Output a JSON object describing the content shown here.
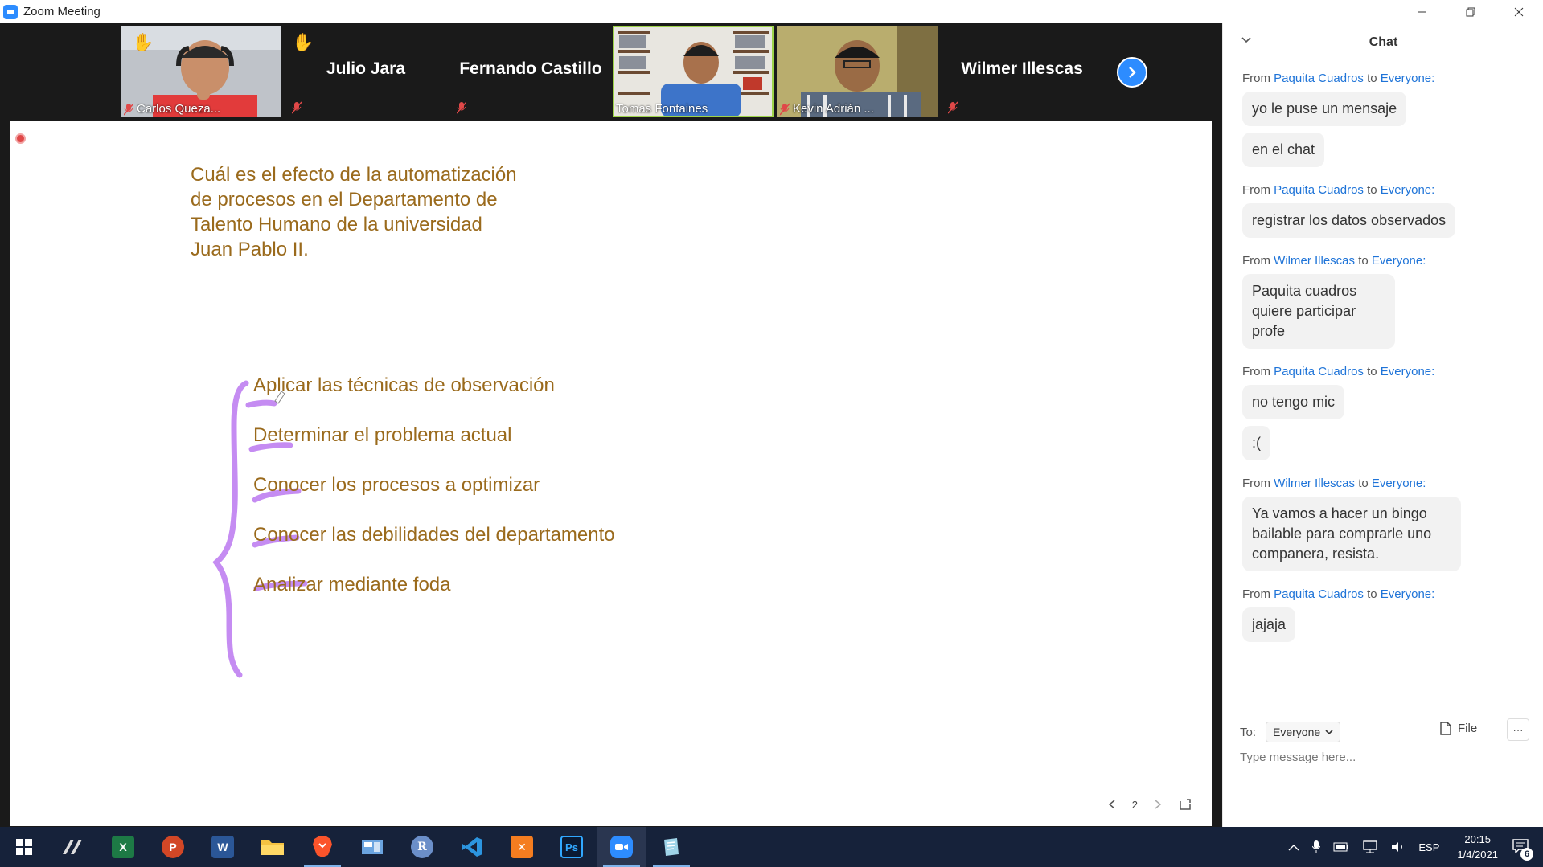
{
  "window": {
    "title": "Zoom Meeting"
  },
  "participants": [
    {
      "name": "Carlos Queza...",
      "type": "video",
      "hand_raised": true,
      "muted": true
    },
    {
      "name": "Julio Jara",
      "type": "name",
      "hand_raised": true,
      "muted": true
    },
    {
      "name": "Fernando Castillo",
      "type": "name",
      "hand_raised": false,
      "muted": true
    },
    {
      "name": "Tomas Fontaines",
      "type": "video",
      "active_speaker": true,
      "muted": false
    },
    {
      "name": "Kevin Adrián ...",
      "type": "video",
      "muted": true
    },
    {
      "name": "Wilmer Illescas",
      "type": "name",
      "muted": true
    }
  ],
  "whiteboard": {
    "question": "Cuál es el efecto de la automatización de procesos en el Departamento de Talento Humano de la universidad Juan Pablo II.",
    "bullets": [
      "Aplicar las técnicas de observación",
      "Determinar el problema actual",
      "Conocer los procesos a optimizar",
      "Conocer las debilidades del departamento",
      "Analizar mediante foda"
    ],
    "page": "2",
    "text_color": "#9a6a1c",
    "ink_color": "#c58cf2"
  },
  "chat": {
    "title": "Chat",
    "messages": [
      {
        "from": "Paquita Cuadros",
        "to": "Everyone:",
        "texts": [
          "yo le puse un mensaje",
          "en el chat"
        ]
      },
      {
        "from": "Paquita Cuadros",
        "to": "Everyone:",
        "texts": [
          "registrar los datos observados"
        ]
      },
      {
        "from": "Wilmer Illescas",
        "to": "Everyone:",
        "texts": [
          "Paquita cuadros quiere participar profe"
        ]
      },
      {
        "from": "Paquita Cuadros",
        "to": "Everyone:",
        "texts": [
          "no tengo mic",
          ":("
        ]
      },
      {
        "from": "Wilmer Illescas",
        "to": "Everyone:",
        "texts": [
          "Ya vamos a hacer un bingo bailable para comprarle uno companera, resista."
        ]
      },
      {
        "from": "Paquita Cuadros",
        "to": "Everyone:",
        "texts": [
          "jajaja"
        ]
      }
    ],
    "from_word": "From",
    "to_word": "to",
    "to_label": "To:",
    "recipient": "Everyone",
    "file_label": "File",
    "more_label": "···",
    "input_placeholder": "Type message here..."
  },
  "taskbar": {
    "apps": [
      "windows-start",
      "authoring-tool",
      "excel",
      "powerpoint",
      "word",
      "file-explorer",
      "brave",
      "control-panel",
      "r",
      "vscode",
      "xampp",
      "photoshop",
      "zoom",
      "notepad"
    ],
    "language": "ESP",
    "time": "20:15",
    "date": "1/4/2021",
    "notification_count": "6"
  }
}
